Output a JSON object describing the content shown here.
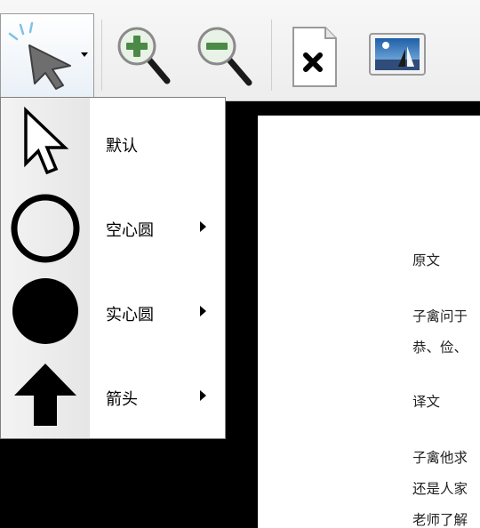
{
  "toolbar": {
    "buttons": [
      {
        "icon": "pointer-cursor-icon",
        "has_dropdown": true
      },
      {
        "icon": "zoom-in-icon"
      },
      {
        "icon": "zoom-out-icon"
      },
      {
        "icon": "clear-page-icon"
      },
      {
        "icon": "insert-image-icon"
      }
    ]
  },
  "pointer_menu": {
    "items": [
      {
        "label": "默认",
        "icon": "arrow-cursor-outline-icon",
        "has_submenu": false
      },
      {
        "label": "空心圆",
        "icon": "hollow-circle-icon",
        "has_submenu": true
      },
      {
        "label": "实心圆",
        "icon": "solid-circle-icon",
        "has_submenu": true
      },
      {
        "label": "箭头",
        "icon": "up-arrow-icon",
        "has_submenu": true
      }
    ]
  },
  "document": {
    "lines": [
      "原文",
      "子禽问于",
      "恭、俭、",
      "译文",
      "子禽他求",
      "还是人家",
      "老师了解"
    ]
  },
  "colors": {
    "background": "#000000",
    "toolbar": "#efefef",
    "menu_gutter": "#ececec",
    "zoom_accent": "#4a8a46",
    "cursor_accent": "#7fc1e8"
  }
}
